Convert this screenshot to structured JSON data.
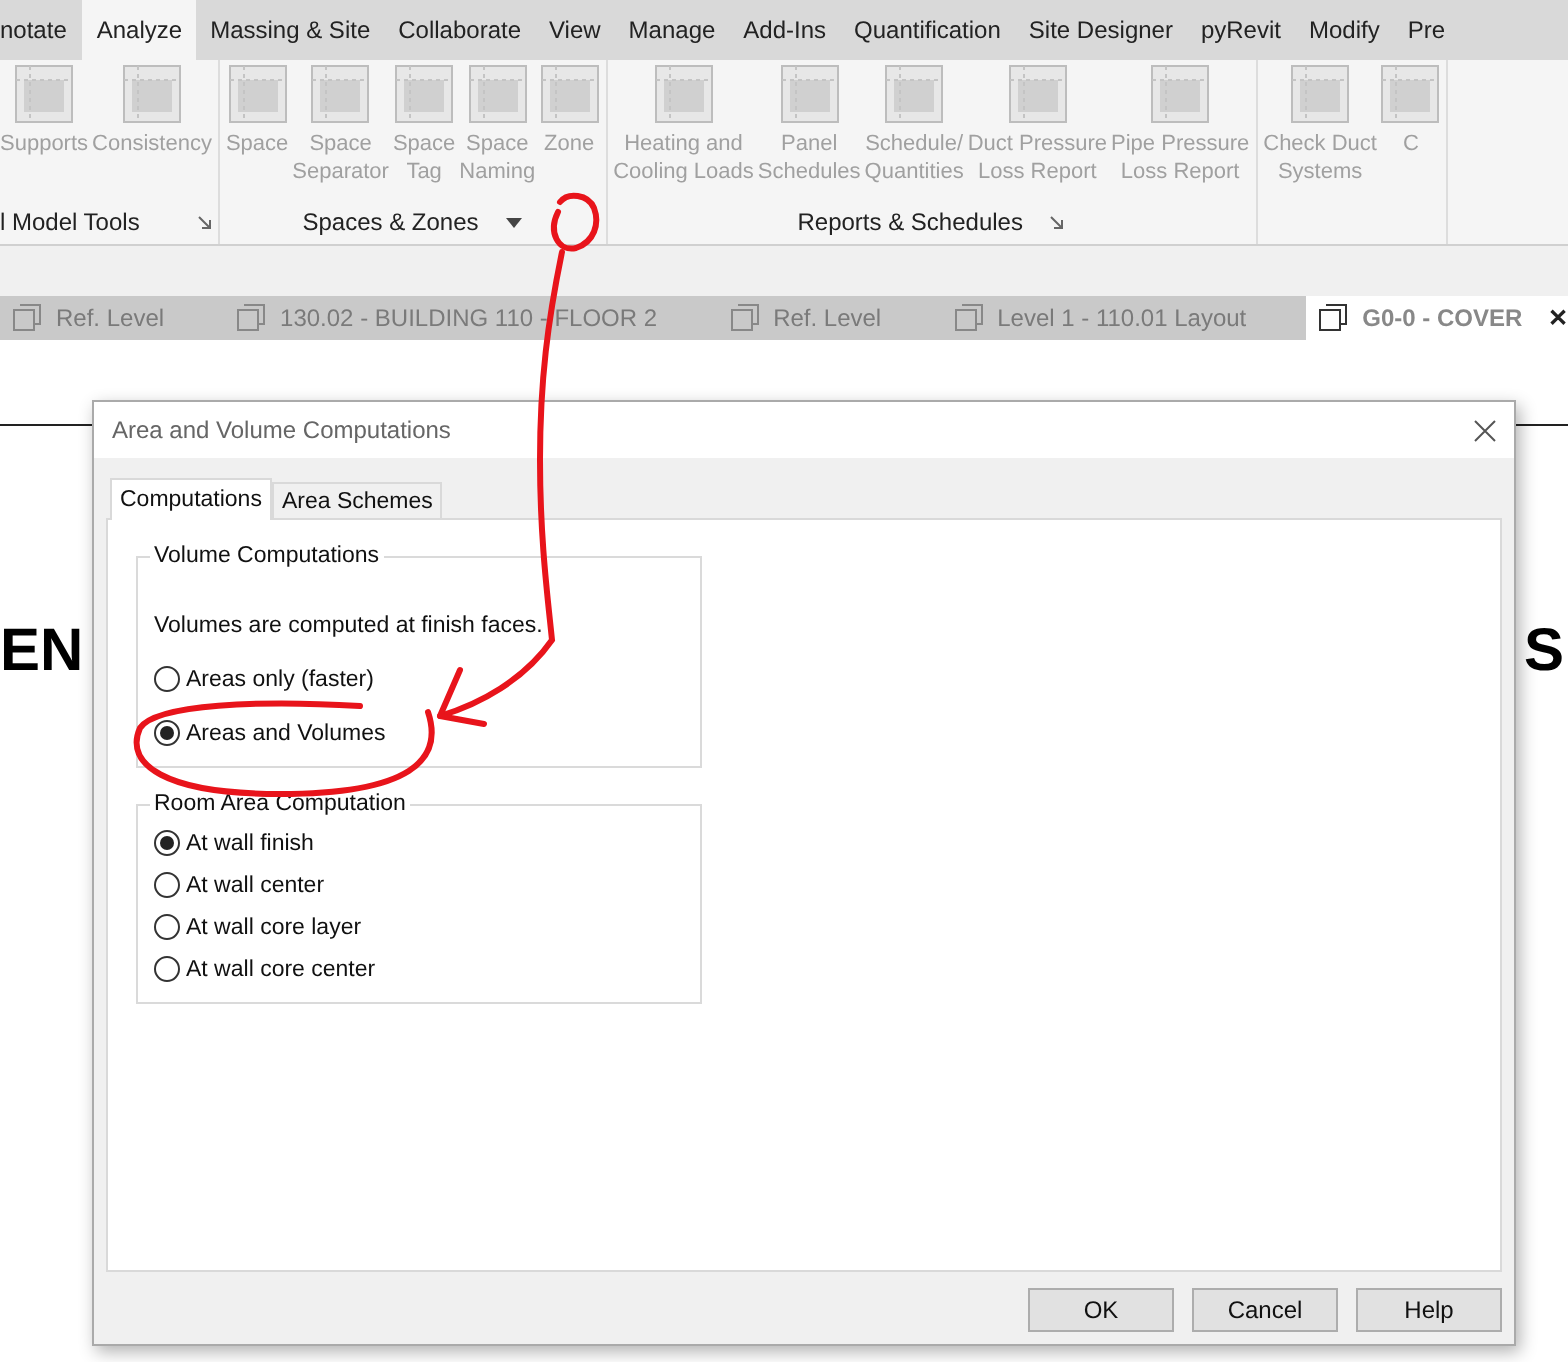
{
  "menu_tabs": [
    {
      "label": "notate",
      "selected": false
    },
    {
      "label": "Analyze",
      "selected": true
    },
    {
      "label": "Massing & Site",
      "selected": false
    },
    {
      "label": "Collaborate",
      "selected": false
    },
    {
      "label": "View",
      "selected": false
    },
    {
      "label": "Manage",
      "selected": false
    },
    {
      "label": "Add-Ins",
      "selected": false
    },
    {
      "label": "Quantification",
      "selected": false
    },
    {
      "label": "Site Designer",
      "selected": false
    },
    {
      "label": "pyRevit",
      "selected": false
    },
    {
      "label": "Modify",
      "selected": false
    },
    {
      "label": "Pre",
      "selected": false
    }
  ],
  "ribbon_panels": [
    {
      "title": "l Model Tools",
      "has_launcher": true,
      "has_dropdown": false,
      "tools": [
        {
          "label": "Supports",
          "disabled": true
        },
        {
          "label": "Consistency",
          "disabled": true
        }
      ]
    },
    {
      "title": "Spaces & Zones",
      "has_launcher": false,
      "has_dropdown": true,
      "tools": [
        {
          "label": "Space",
          "disabled": true
        },
        {
          "label": "Space\nSeparator",
          "disabled": true
        },
        {
          "label": "Space\nTag",
          "disabled": true
        },
        {
          "label": "Space\nNaming",
          "disabled": true
        },
        {
          "label": "Zone",
          "disabled": true
        }
      ]
    },
    {
      "title": "Reports & Schedules",
      "has_launcher": true,
      "has_dropdown": false,
      "tools": [
        {
          "label": "Heating and\nCooling Loads",
          "disabled": true
        },
        {
          "label": "Panel\nSchedules",
          "disabled": true
        },
        {
          "label": "Schedule/\nQuantities",
          "disabled": true
        },
        {
          "label": "Duct Pressure\nLoss Report",
          "disabled": true
        },
        {
          "label": "Pipe Pressure\nLoss Report",
          "disabled": true
        }
      ]
    },
    {
      "has_launcher": false,
      "has_dropdown": false,
      "tools": [
        {
          "label": "Check Duct\nSystems",
          "disabled": true
        },
        {
          "label": "C",
          "disabled": true
        }
      ]
    }
  ],
  "view_tabs": [
    {
      "label": "Ref. Level",
      "selected": false
    },
    {
      "label": "130.02 - BUILDING 110 - FLOOR 2",
      "selected": false
    },
    {
      "label": "Ref. Level",
      "selected": false
    },
    {
      "label": "Level 1 - 110.01 Layout",
      "selected": false
    },
    {
      "label": "G0-0 - COVER",
      "selected": true,
      "close": "✕"
    }
  ],
  "canvas": {
    "left_text": "EN",
    "right_text": "S"
  },
  "dialog": {
    "title": "Area and Volume Computations",
    "tabs": [
      {
        "label": "Computations",
        "selected": true
      },
      {
        "label": "Area Schemes",
        "selected": false
      }
    ],
    "groups": [
      {
        "title": "Volume Computations",
        "note": "Volumes are computed at finish faces.",
        "options": [
          {
            "label": "Areas only (faster)",
            "selected": false
          },
          {
            "label": "Areas and Volumes",
            "selected": true
          }
        ]
      },
      {
        "title": "Room Area Computation",
        "options": [
          {
            "label": "At wall finish",
            "selected": true
          },
          {
            "label": "At wall center",
            "selected": false
          },
          {
            "label": "At wall core layer",
            "selected": false
          },
          {
            "label": "At wall core center",
            "selected": false
          }
        ]
      }
    ],
    "buttons": [
      {
        "label": "OK"
      },
      {
        "label": "Cancel"
      },
      {
        "label": "Help"
      }
    ]
  }
}
